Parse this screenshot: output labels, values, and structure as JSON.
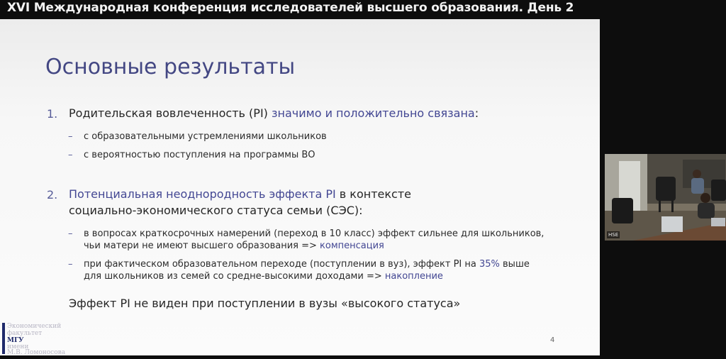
{
  "stream": {
    "title": "XVI Международная конференция исследователей высшего образования. День 2"
  },
  "slide": {
    "title": "Основные результаты",
    "item1": {
      "number": "1.",
      "text_plain": "Родительская вовлеченность (PI) ",
      "text_accent": "значимо и положительно связана",
      "text_tail": ":",
      "bullets": [
        "с образовательными устремлениями школьников",
        "с вероятностью поступления на программы ВО"
      ]
    },
    "item2": {
      "number": "2.",
      "line1_accent": "Потенциальная неоднородность эффекта PI",
      "line1_tail": " в контексте",
      "line2": "социально-экономического статуса семьи (СЭС):",
      "bullet1_line1": "в вопросах краткосрочных намерений (переход в 10 класс) эффект сильнее для школьников,",
      "bullet1_line2_plain": "чьи матери не имеют высшего образования => ",
      "bullet1_line2_accent": "компенсация",
      "bullet2_line1_plain": "при фактическом образовательном переходе (поступлении в вуз), эффект PI на ",
      "bullet2_line1_accent": "35%",
      "bullet2_line1_tail": " выше",
      "bullet2_line2_plain": "для школьников из семей со средне-высокими доходами => ",
      "bullet2_line2_accent": "накопление"
    },
    "conclusion": "Эффект PI не виден при поступлении в вузы «высокого статуса»",
    "page_number": "4",
    "logo": {
      "line1": "Экономический",
      "line2": "факультет",
      "line3": "МГУ",
      "line4": "имени",
      "line5": "М.В. Ломоносова"
    },
    "dash": "–"
  },
  "webcam": {
    "badge": "HSE"
  },
  "colors": {
    "accent": "#434793",
    "title": "#434783",
    "background": "#0d0d0d"
  }
}
